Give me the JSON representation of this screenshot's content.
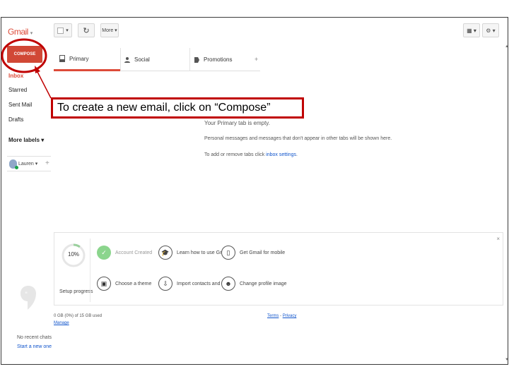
{
  "app": {
    "logo": "Gmail",
    "logo_caret": "▾"
  },
  "toolbar": {
    "select_caret": "▾",
    "refresh_symbol": "↻",
    "more_label": "More ▾",
    "view_toggle": "▦ ▾",
    "settings_symbol": "⚙ ▾"
  },
  "sidebar": {
    "compose_label": "COMPOSE",
    "items": [
      {
        "label": "Inbox"
      },
      {
        "label": "Starred"
      },
      {
        "label": "Sent Mail"
      },
      {
        "label": "Drafts"
      },
      {
        "label": "More labels ▾"
      }
    ],
    "user": {
      "name": "Lauren ▾",
      "add_symbol": "+"
    },
    "hangouts": {
      "caption": "No recent chats",
      "link": "Start a new one"
    }
  },
  "tabs": [
    {
      "label": "Primary",
      "icon": "inbox-icon"
    },
    {
      "label": "Social",
      "icon": "people-icon"
    },
    {
      "label": "Promotions",
      "icon": "tag-icon"
    }
  ],
  "tab_add_symbol": "+",
  "empty_state": {
    "title": "Your Primary tab is empty.",
    "line1": "Personal messages and messages that don't appear in other tabs will be shown here.",
    "line2_prefix": "To add or remove tabs click ",
    "line2_link": "inbox settings",
    "line2_suffix": "."
  },
  "setup": {
    "close_symbol": "×",
    "progress": 0.1,
    "progress_label": "10%",
    "caption": "Setup progress",
    "tasks": [
      {
        "label": "Account Created",
        "icon": "check-icon",
        "done": true
      },
      {
        "label": "Learn how to use Gmail",
        "icon": "graduation-cap-icon",
        "done": false
      },
      {
        "label": "Get Gmail for mobile",
        "icon": "phone-icon",
        "done": false
      },
      {
        "label": "Choose a theme",
        "icon": "image-icon",
        "done": false
      },
      {
        "label": "Import contacts and mail",
        "icon": "import-contacts-icon",
        "done": false
      },
      {
        "label": "Change profile image",
        "icon": "profile-icon",
        "done": false
      }
    ]
  },
  "footer": {
    "storage": "0 GB (0%) of 15 GB used",
    "manage": "Manage",
    "terms": "Terms",
    "sep": " - ",
    "privacy": "Privacy"
  },
  "annotation": {
    "text": "To create a new email, click on “Compose”",
    "color": "#c00000"
  },
  "colors": {
    "brand": "#dd4b39",
    "compose": "#d14836",
    "link": "#1155cc",
    "done_check": "#8bd58d"
  }
}
